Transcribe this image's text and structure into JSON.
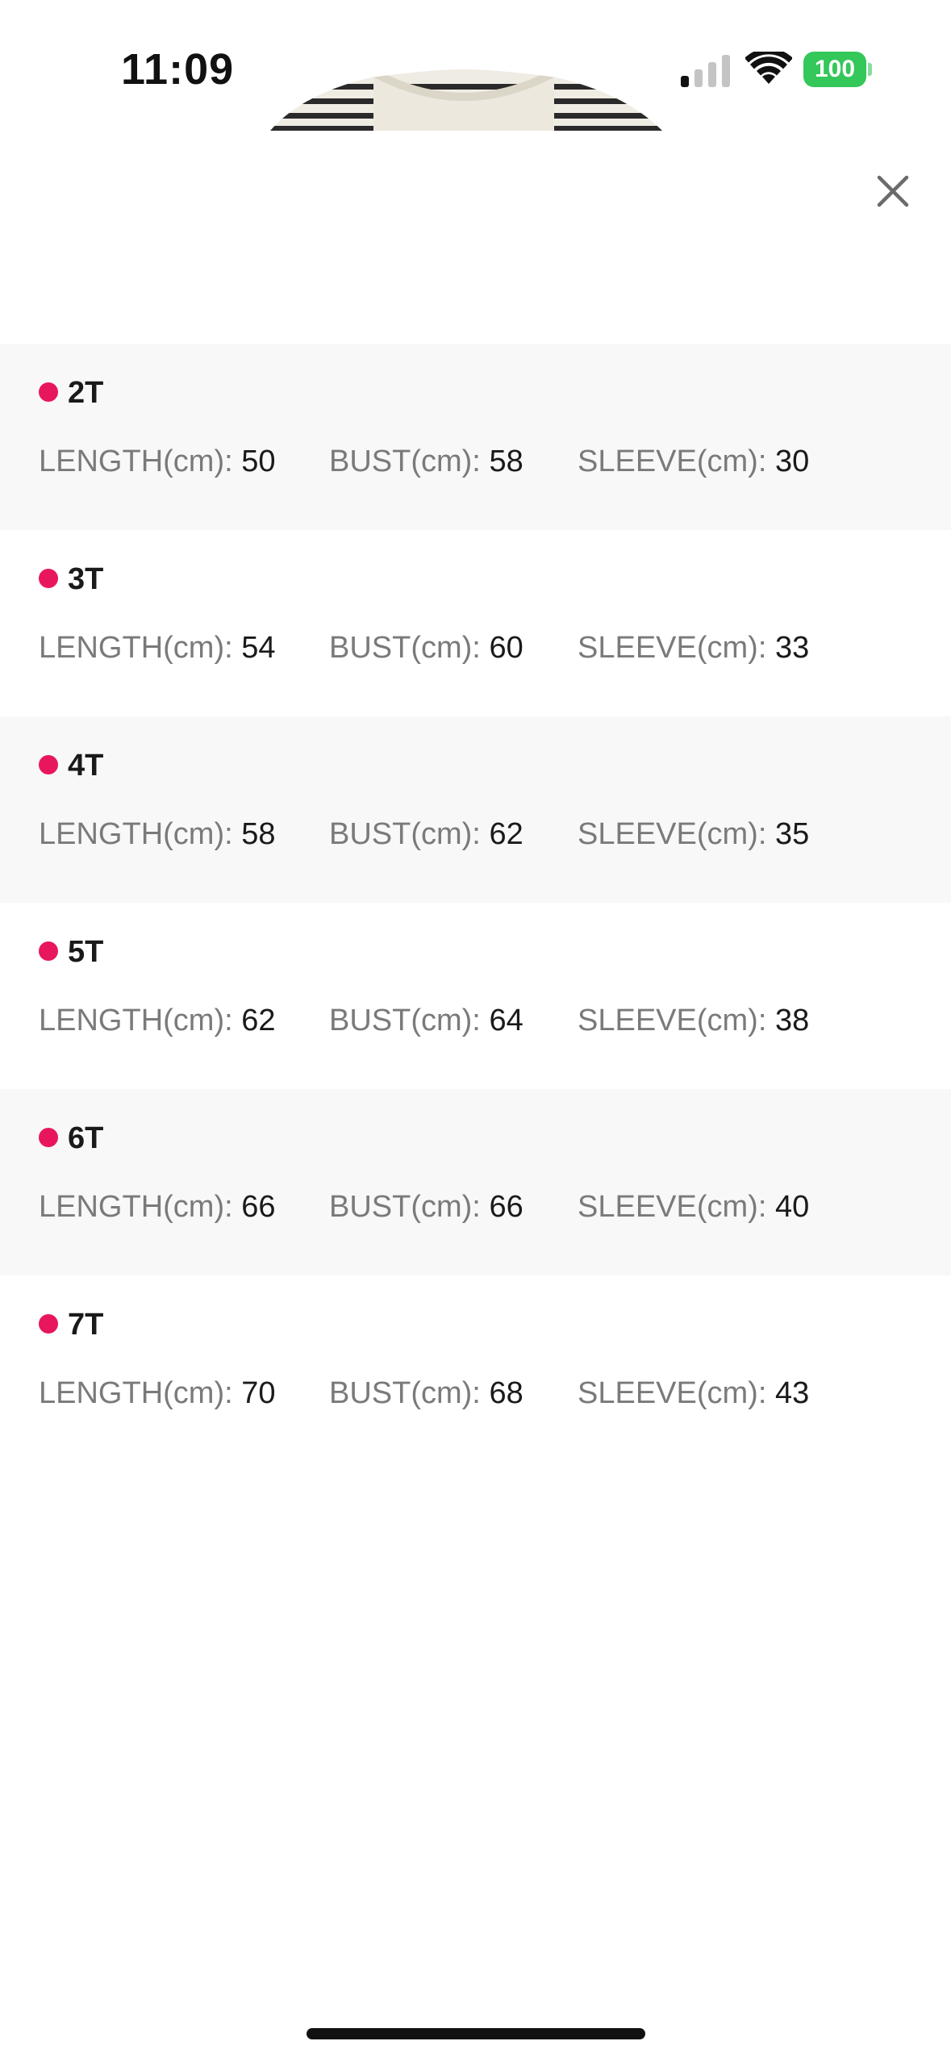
{
  "status_bar": {
    "time": "11:09",
    "battery_level": "100",
    "battery_color": "#34c759",
    "signal_icon": "cellular-signal-icon",
    "wifi_icon": "wifi-icon"
  },
  "close_icon": "close-icon",
  "accent_color": "#e8175d",
  "sizes": [
    {
      "name": "2T",
      "length_label": "LENGTH(cm): ",
      "length": "50",
      "bust_label": "BUST(cm): ",
      "bust": "58",
      "sleeve_label": "SLEEVE(cm): ",
      "sleeve": "30"
    },
    {
      "name": "3T",
      "length_label": "LENGTH(cm): ",
      "length": "54",
      "bust_label": "BUST(cm): ",
      "bust": "60",
      "sleeve_label": "SLEEVE(cm): ",
      "sleeve": "33"
    },
    {
      "name": "4T",
      "length_label": "LENGTH(cm): ",
      "length": "58",
      "bust_label": "BUST(cm): ",
      "bust": "62",
      "sleeve_label": "SLEEVE(cm): ",
      "sleeve": "35"
    },
    {
      "name": "5T",
      "length_label": "LENGTH(cm): ",
      "length": "62",
      "bust_label": "BUST(cm): ",
      "bust": "64",
      "sleeve_label": "SLEEVE(cm): ",
      "sleeve": "38"
    },
    {
      "name": "6T",
      "length_label": "LENGTH(cm): ",
      "length": "66",
      "bust_label": "BUST(cm): ",
      "bust": "66",
      "sleeve_label": "SLEEVE(cm): ",
      "sleeve": "40"
    },
    {
      "name": "7T",
      "length_label": "LENGTH(cm): ",
      "length": "70",
      "bust_label": "BUST(cm): ",
      "bust": "68",
      "sleeve_label": "SLEEVE(cm): ",
      "sleeve": "43"
    }
  ]
}
